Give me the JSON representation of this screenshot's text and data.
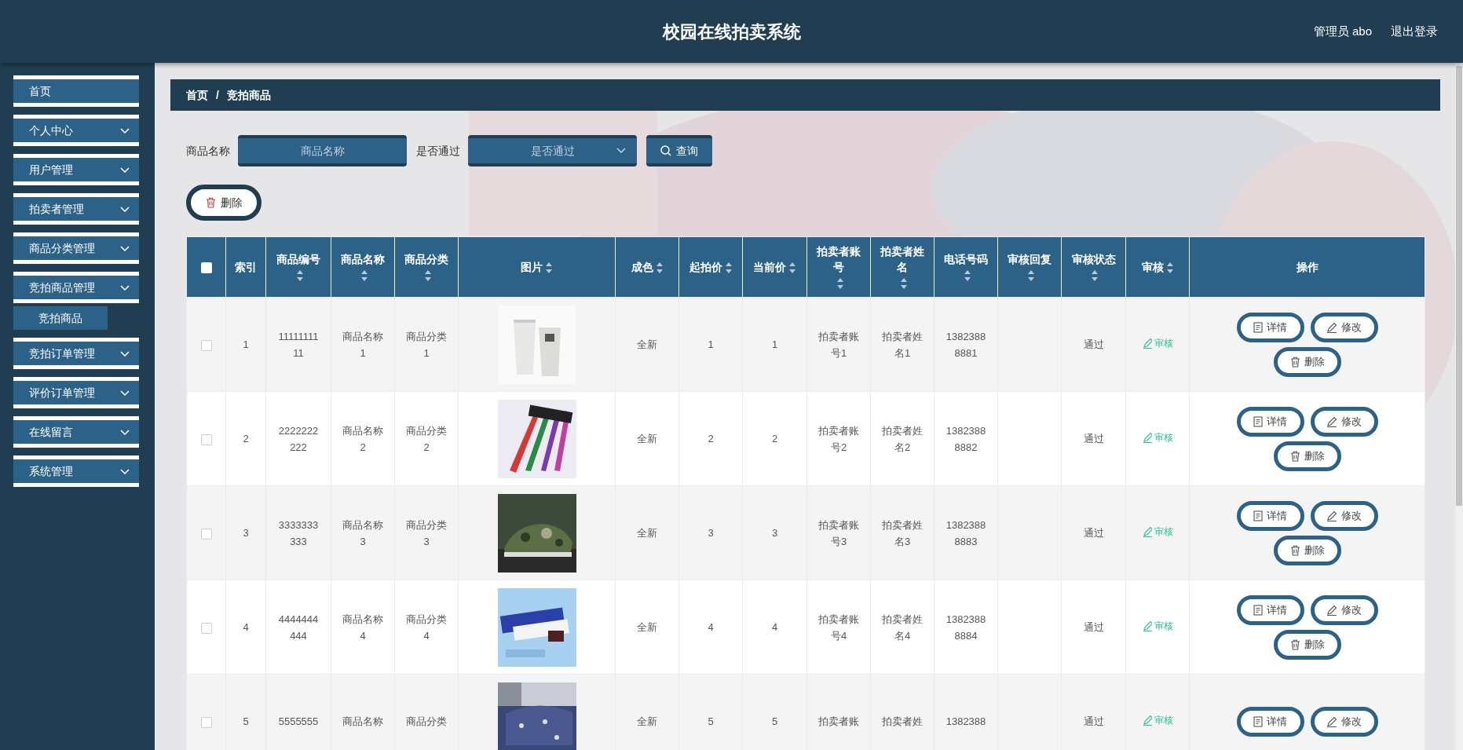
{
  "header": {
    "title": "校园在线拍卖系统",
    "user": "管理员 abo",
    "logout": "退出登录"
  },
  "sidebar": {
    "items": [
      {
        "label": "首页",
        "dropdown": false
      },
      {
        "label": "个人中心",
        "dropdown": true
      },
      {
        "label": "用户管理",
        "dropdown": true
      },
      {
        "label": "拍卖者管理",
        "dropdown": true
      },
      {
        "label": "商品分类管理",
        "dropdown": true
      },
      {
        "label": "竞拍商品管理",
        "dropdown": true,
        "children": [
          {
            "label": "竞拍商品"
          }
        ]
      },
      {
        "label": "竞拍订单管理",
        "dropdown": true
      },
      {
        "label": "评价订单管理",
        "dropdown": true
      },
      {
        "label": "在线留言",
        "dropdown": true
      },
      {
        "label": "系统管理",
        "dropdown": true
      }
    ]
  },
  "breadcrumb": {
    "items": [
      "首页",
      "竞拍商品"
    ],
    "separator": "/"
  },
  "search": {
    "fields": [
      {
        "kind": "input",
        "label": "商品名称",
        "placeholder": "商品名称"
      },
      {
        "kind": "select",
        "label": "是否通过",
        "placeholder": "是否通过"
      }
    ],
    "button": "查询"
  },
  "toolbar": {
    "delete_button": "删除"
  },
  "table": {
    "select_all": {
      "checked": false
    },
    "columns": [
      {
        "label": "索引",
        "sortable": false
      },
      {
        "label": "商品编号",
        "sortable": true
      },
      {
        "label": "商品名称",
        "sortable": true
      },
      {
        "label": "商品分类",
        "sortable": true
      },
      {
        "label": "图片",
        "sortable": true
      },
      {
        "label": "成色",
        "sortable": true
      },
      {
        "label": "起拍价",
        "sortable": true
      },
      {
        "label": "当前价",
        "sortable": true
      },
      {
        "label": "拍卖者账号",
        "sortable": true
      },
      {
        "label": "拍卖者姓名",
        "sortable": true
      },
      {
        "label": "电话号码",
        "sortable": true
      },
      {
        "label": "审核回复",
        "sortable": true
      },
      {
        "label": "审核状态",
        "sortable": true
      },
      {
        "label": "审核",
        "sortable": true
      },
      {
        "label": "操作",
        "sortable": false
      }
    ],
    "rows": [
      {
        "checked": false,
        "index": "1",
        "sku": "1111111111",
        "name": "商品名称1",
        "category": "商品分类1",
        "image": {
          "kind": "picture"
        },
        "condition": "全新",
        "start_price": "1",
        "current_price": "1",
        "seller_account": "拍卖者账号1",
        "seller_name": "拍卖者姓名1",
        "phone": "13823888881",
        "review_status": "通过",
        "review_action": "审核",
        "actions": [
          {
            "kind": "detail",
            "label": "详情"
          },
          {
            "kind": "edit",
            "label": "修改"
          },
          {
            "kind": "delete",
            "label": "删除"
          }
        ]
      },
      {
        "checked": false,
        "index": "2",
        "sku": "2222222222",
        "name": "商品名称2",
        "category": "商品分类2",
        "image": {
          "kind": "picture"
        },
        "condition": "全新",
        "start_price": "2",
        "current_price": "2",
        "seller_account": "拍卖者账号2",
        "seller_name": "拍卖者姓名2",
        "phone": "13823888882",
        "review_status": "通过",
        "review_action": "审核",
        "actions": [
          {
            "kind": "detail",
            "label": "详情"
          },
          {
            "kind": "edit",
            "label": "修改"
          },
          {
            "kind": "delete",
            "label": "删除"
          }
        ]
      },
      {
        "checked": false,
        "index": "3",
        "sku": "3333333333",
        "name": "商品名称3",
        "category": "商品分类3",
        "image": {
          "kind": "picture"
        },
        "condition": "全新",
        "start_price": "3",
        "current_price": "3",
        "seller_account": "拍卖者账号3",
        "seller_name": "拍卖者姓名3",
        "phone": "13823888883",
        "review_status": "通过",
        "review_action": "审核",
        "actions": [
          {
            "kind": "detail",
            "label": "详情"
          },
          {
            "kind": "edit",
            "label": "修改"
          },
          {
            "kind": "delete",
            "label": "删除"
          }
        ]
      },
      {
        "checked": false,
        "index": "4",
        "sku": "4444444444",
        "name": "商品名称4",
        "category": "商品分类4",
        "image": {
          "kind": "picture"
        },
        "condition": "全新",
        "start_price": "4",
        "current_price": "4",
        "seller_account": "拍卖者账号4",
        "seller_name": "拍卖者姓名4",
        "phone": "13823888884",
        "review_status": "通过",
        "review_action": "审核",
        "actions": [
          {
            "kind": "detail",
            "label": "详情"
          },
          {
            "kind": "edit",
            "label": "修改"
          },
          {
            "kind": "delete",
            "label": "删除"
          }
        ]
      },
      {
        "checked": false,
        "index": "5",
        "sku": "5555555",
        "name": "商品名称",
        "category": "商品分类",
        "image": {
          "kind": "picture"
        },
        "condition": "全新",
        "start_price": "5",
        "current_price": "5",
        "seller_account": "拍卖者账",
        "seller_name": "拍卖者姓",
        "phone": "1382388",
        "review_status": "通过",
        "review_action": "审核",
        "actions": [
          {
            "kind": "detail",
            "label": "详情"
          },
          {
            "kind": "edit",
            "label": "修改"
          }
        ]
      }
    ]
  }
}
